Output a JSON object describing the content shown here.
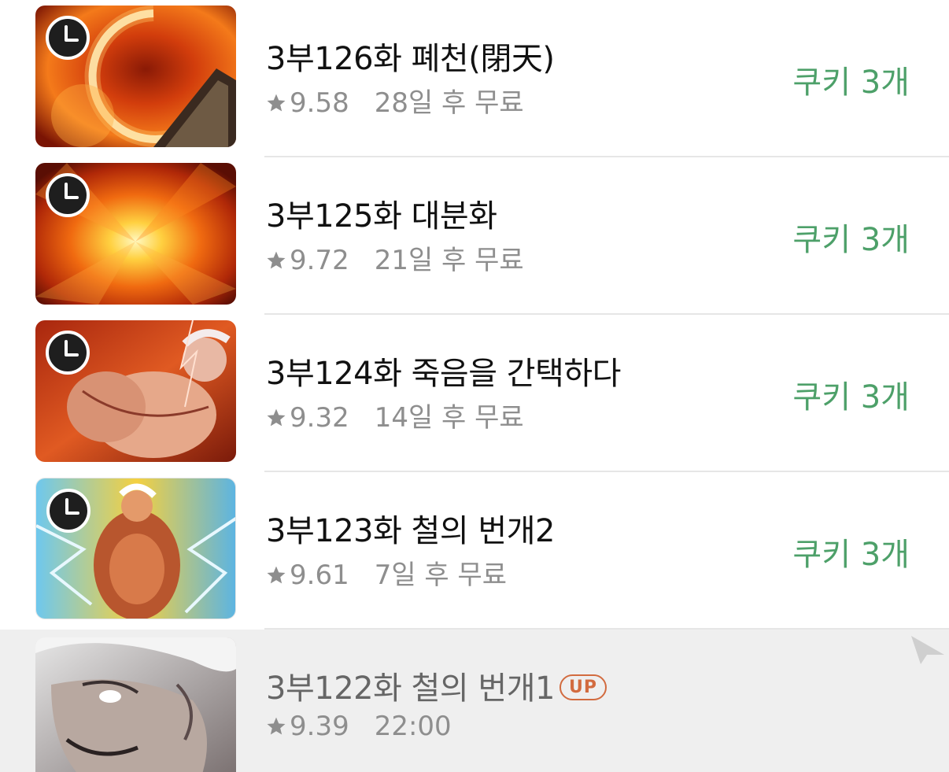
{
  "episodes": [
    {
      "title": "3부126화 폐천(閉天)",
      "rating": "9.58",
      "status": "28일 후 무료",
      "price": "쿠키 3개",
      "thumb_icon": "clock-icon"
    },
    {
      "title": "3부125화 대분화",
      "rating": "9.72",
      "status": "21일 후 무료",
      "price": "쿠키 3개",
      "thumb_icon": "clock-icon"
    },
    {
      "title": "3부124화 죽음을 간택하다",
      "rating": "9.32",
      "status": "14일 후 무료",
      "price": "쿠키 3개",
      "thumb_icon": "clock-icon"
    },
    {
      "title": "3부123화 철의 번개2",
      "rating": "9.61",
      "status": "7일 후 무료",
      "price": "쿠키 3개",
      "thumb_icon": "clock-icon"
    },
    {
      "title": "3부122화 철의 번개1",
      "badge": "UP",
      "rating": "9.39",
      "status": "22:00"
    }
  ],
  "colors": {
    "price_green": "#4da069",
    "badge_orange": "#d26b3f",
    "meta_gray": "#8e8e8e",
    "current_row_bg": "#efefef"
  },
  "icons": {
    "rating": "star-icon",
    "wait_free": "clock-icon",
    "cursor": "pointer-arrow-icon"
  }
}
